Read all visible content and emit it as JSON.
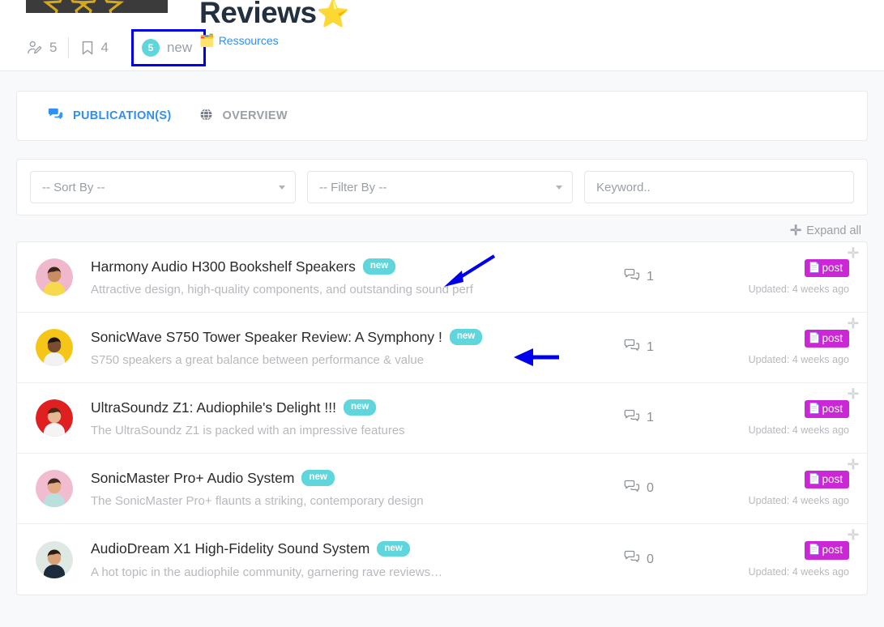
{
  "header": {
    "title": "Reviews",
    "title_star": "⭐",
    "resources_label": "Ressources",
    "resources_icon": "card-index-dividers-icon",
    "stats": {
      "authors_icon": "user-edit-icon",
      "authors_count": "5",
      "bookmarks_icon": "bookmark-icon",
      "bookmarks_count": "4",
      "new_count": "5",
      "new_label": "new"
    }
  },
  "tabs": [
    {
      "label": "PUBLICATION(S)",
      "icon": "comments-icon",
      "active": true
    },
    {
      "label": "OVERVIEW",
      "icon": "globe-icon",
      "active": false
    }
  ],
  "filters": {
    "sort_by": "-- Sort By --",
    "filter_by": "-- Filter By --",
    "keyword_placeholder": "Keyword.."
  },
  "list_toolbar": {
    "expand_all": "Expand all",
    "expand_icon": "plus-icon"
  },
  "rows": [
    {
      "title": "Harmony Audio H300 Bookshelf Speakers",
      "badge": "new",
      "subtitle": "Attractive design, high-quality components, and outstanding sound perf",
      "comments": "1",
      "type_badge": "post",
      "updated": "Updated: 4 weeks ago",
      "avatar_bg": "#f0b8cd",
      "avatar_shirt": "#f7d94c",
      "avatar_hair": "#3a2318",
      "avatar_skin": "#c98c63"
    },
    {
      "title": "SonicWave S750 Tower Speaker Review: A Symphony !",
      "badge": "new",
      "subtitle": "S750 speakers a great balance between performance & value",
      "comments": "1",
      "type_badge": "post",
      "updated": "Updated: 4 weeks ago",
      "avatar_bg": "#f5c518",
      "avatar_shirt": "#f2f2f2",
      "avatar_hair": "#1d1410",
      "avatar_skin": "#7a4d2e"
    },
    {
      "title": "UltraSoundz Z1: Audiophile's Delight !!!",
      "badge": "new",
      "subtitle": "The UltraSoundz Z1 is packed with an impressive features",
      "comments": "1",
      "type_badge": "post",
      "updated": "Updated: 4 weeks ago",
      "avatar_bg": "#e02020",
      "avatar_shirt": "#f4f4f4",
      "avatar_hair": "#4a2a16",
      "avatar_skin": "#e8b894"
    },
    {
      "title": "SonicMaster Pro+ Audio System",
      "badge": "new",
      "subtitle": "The SonicMaster Pro+ flaunts a striking, contemporary design",
      "comments": "0",
      "type_badge": "post",
      "updated": "Updated: 4 weeks ago",
      "avatar_bg": "#f2bcd0",
      "avatar_shirt": "#b9e0dd",
      "avatar_hair": "#3d2a1c",
      "avatar_skin": "#e3ab84"
    },
    {
      "title": "AudioDream X1 High-Fidelity Sound System",
      "badge": "new",
      "subtitle": "A hot topic in the audiophile community, garnering rave reviews…",
      "comments": "0",
      "type_badge": "post",
      "updated": "Updated: 4 weeks ago",
      "avatar_bg": "#dfe9e4",
      "avatar_shirt": "#1d2c3c",
      "avatar_hair": "#2a1c13",
      "avatar_skin": "#d9a178"
    }
  ],
  "colors": {
    "accent_blue": "#2f8ff5",
    "badge_new": "#5fd6db",
    "badge_post": "#cc27d6",
    "annotation": "#0000ee",
    "muted_text": "#9aa0a6"
  }
}
